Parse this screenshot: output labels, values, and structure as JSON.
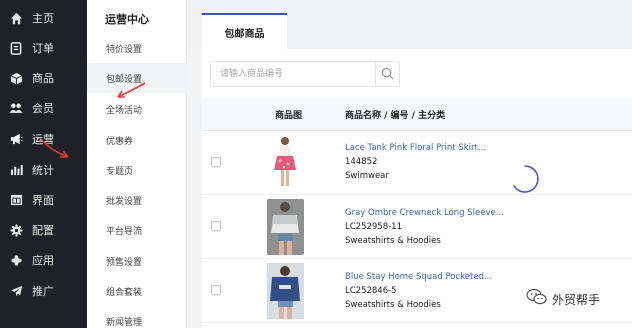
{
  "nav": {
    "items": [
      {
        "label": "主页",
        "icon": "home-icon"
      },
      {
        "label": "订单",
        "icon": "order-icon"
      },
      {
        "label": "商品",
        "icon": "box-icon"
      },
      {
        "label": "会员",
        "icon": "members-icon"
      },
      {
        "label": "运营",
        "icon": "megaphone-icon",
        "active": true
      },
      {
        "label": "统计",
        "icon": "bar-chart-icon"
      },
      {
        "label": "界面",
        "icon": "layout-icon"
      },
      {
        "label": "配置",
        "icon": "gear-icon"
      },
      {
        "label": "应用",
        "icon": "apps-icon"
      },
      {
        "label": "推广",
        "icon": "send-icon"
      }
    ]
  },
  "subnav": {
    "title": "运营中心",
    "items": [
      {
        "label": "特价设置"
      },
      {
        "label": "包邮设置",
        "active": true
      },
      {
        "label": "全场活动"
      },
      {
        "label": "优惠券"
      },
      {
        "label": "专题页"
      },
      {
        "label": "批发设置"
      },
      {
        "label": "平台导流"
      },
      {
        "label": "预售设置"
      },
      {
        "label": "组合套装"
      },
      {
        "label": "新闻管理"
      }
    ]
  },
  "tab": {
    "label": "包邮商品"
  },
  "search": {
    "placeholder": "请输入商品编号"
  },
  "table": {
    "headers": {
      "image": "商品图",
      "info": "商品名称 / 编号 / 主分类"
    },
    "rows": [
      {
        "name": "Lace Tank Pink Floral Print Skirt...",
        "code": "144852",
        "category": "Swimwear"
      },
      {
        "name": "Gray Ombre Crewneck Long Sleeve...",
        "code": "LC252958-11",
        "category": "Sweatshirts & Hoodies"
      },
      {
        "name": "Blue Stay Home Squad Pocketed...",
        "code": "LC252846-5",
        "category": "Sweatshirts & Hoodies"
      }
    ]
  },
  "watermark": {
    "text": "外贸帮手"
  },
  "colors": {
    "nav_bg": "#1f2126",
    "accent": "#3f51b5",
    "link": "#3f63b5",
    "arrow": "#e53935"
  }
}
